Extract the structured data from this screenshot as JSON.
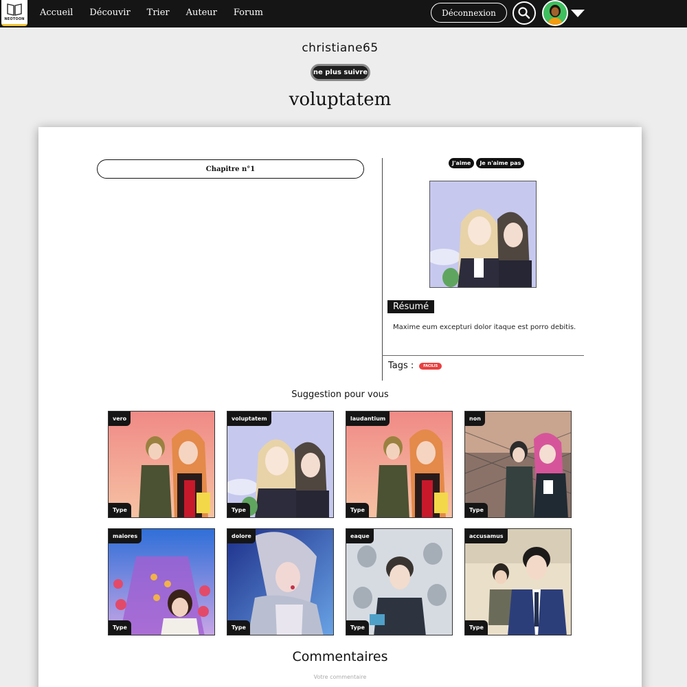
{
  "nav": {
    "logo_text": "NEOTOON",
    "links": [
      "Accueil",
      "Découvir",
      "Trier",
      "Auteur",
      "Forum"
    ],
    "logout_label": "Déconnexion"
  },
  "profile": {
    "username": "christiane65",
    "unfollow_label": "ne plus suivre"
  },
  "work": {
    "title": "voluptatem",
    "chapter_label": "Chapitre n°1",
    "like_label": "J'aime",
    "dislike_label": "Je n'aime pas",
    "resume_label": "Résumé",
    "resume_text": "Maxime eum excepturi dolor itaque est porro debitis.",
    "tags_label": "Tags :",
    "tags": [
      "FACILIS"
    ]
  },
  "suggestions": {
    "title": "Suggestion pour vous",
    "items": [
      {
        "name": "vero",
        "type": "Type"
      },
      {
        "name": "voluptatem",
        "type": "Type"
      },
      {
        "name": "laudantium",
        "type": "Type"
      },
      {
        "name": "non",
        "type": "Type"
      },
      {
        "name": "maiores",
        "type": "Type"
      },
      {
        "name": "dolore",
        "type": "Type"
      },
      {
        "name": "eaque",
        "type": "Type"
      },
      {
        "name": "accusamus",
        "type": "Type"
      }
    ]
  },
  "comments": {
    "title": "Commentaires",
    "placeholder": "Votre commentaire"
  },
  "colors": {
    "nav_bg": "#151515",
    "accent_yellow": "#f1c232",
    "avatar_green": "#3fbf5f",
    "tag_red": "#e94040"
  }
}
